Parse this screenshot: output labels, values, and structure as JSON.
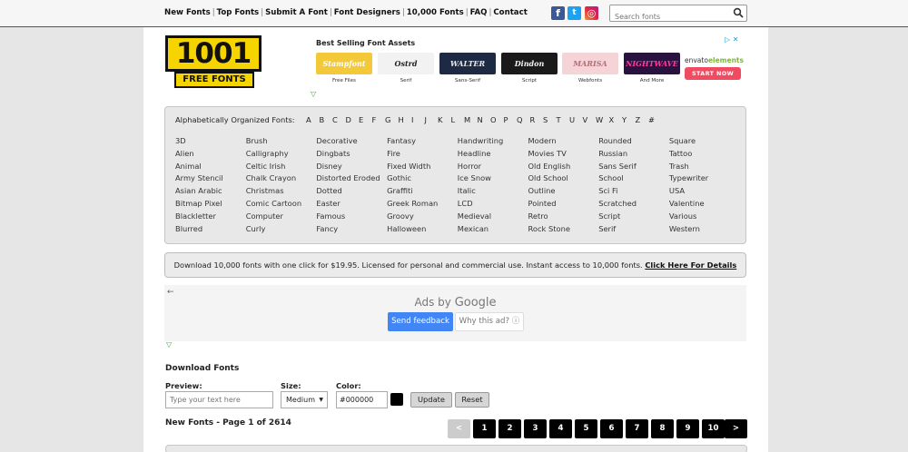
{
  "nav": {
    "items": [
      "New Fonts",
      "Top Fonts",
      "Submit A Font",
      "Font Designers",
      "10,000 Fonts",
      "FAQ",
      "Contact"
    ],
    "separator": "|"
  },
  "social": {
    "facebook": "f",
    "twitter": "t",
    "instagram": "◎"
  },
  "search": {
    "placeholder": "Search fonts"
  },
  "logo": {
    "number": "1001",
    "text": "FREE FONTS"
  },
  "ad": {
    "title": "Best Selling Font Assets",
    "cards": [
      {
        "thumb": "Stampfont",
        "caption": "Free Files",
        "bg": "#f3c93a",
        "fg": "#fff"
      },
      {
        "thumb": "Ostrd",
        "caption": "Serif",
        "bg": "#f2f2f2",
        "fg": "#222"
      },
      {
        "thumb": "WALTER",
        "caption": "Sans-Serif",
        "bg": "#1e2a44",
        "fg": "#e8e8e8"
      },
      {
        "thumb": "Dindon",
        "caption": "Script",
        "bg": "#1a1a1a",
        "fg": "#f5f5f5"
      },
      {
        "thumb": "MARISA",
        "caption": "Webfonts",
        "bg": "#f5d3d6",
        "fg": "#b07078"
      },
      {
        "thumb": "NIGHTWAVE",
        "caption": "And More",
        "bg": "#2a1240",
        "fg": "#ff3d9a"
      }
    ],
    "envato_brand_a": "envato",
    "envato_brand_b": "elements",
    "envato_cta": "START NOW",
    "close_marks": "▷ ✕"
  },
  "alphabet": {
    "label": "Alphabetically Organized Fonts:",
    "letters": [
      "A",
      "B",
      "C",
      "D",
      "E",
      "F",
      "G",
      "H",
      "I",
      "J",
      "K",
      "L",
      "M",
      "N",
      "O",
      "P",
      "Q",
      "R",
      "S",
      "T",
      "U",
      "V",
      "W",
      "X",
      "Y",
      "Z",
      "#"
    ]
  },
  "categories": [
    [
      "3D",
      "Alien",
      "Animal",
      "Army Stencil",
      "Asian Arabic",
      "Bitmap Pixel",
      "Blackletter",
      "Blurred"
    ],
    [
      "Brush",
      "Calligraphy",
      "Celtic Irish",
      "Chalk Crayon",
      "Christmas",
      "Comic Cartoon",
      "Computer",
      "Curly"
    ],
    [
      "Decorative",
      "Dingbats",
      "Disney",
      "Distorted Eroded",
      "Dotted",
      "Easter",
      "Famous",
      "Fancy"
    ],
    [
      "Fantasy",
      "Fire",
      "Fixed Width",
      "Gothic",
      "Graffiti",
      "Greek Roman",
      "Groovy",
      "Halloween"
    ],
    [
      "Handwriting",
      "Headline",
      "Horror",
      "Ice Snow",
      "Italic",
      "LCD",
      "Medieval",
      "Mexican"
    ],
    [
      "Modern",
      "Movies TV",
      "Old English",
      "Old School",
      "Outline",
      "Pointed",
      "Retro",
      "Rock Stone"
    ],
    [
      "Rounded",
      "Russian",
      "Sans Serif",
      "School",
      "Sci Fi",
      "Scratched",
      "Script",
      "Serif"
    ],
    [
      "Square",
      "Tattoo",
      "Trash",
      "Typewriter",
      "USA",
      "Valentine",
      "Various",
      "Western"
    ]
  ],
  "promo": {
    "text": "Download 10,000 fonts with one click for $19.95. Licensed for personal and commercial use. Instant access to 10,000 fonts. ",
    "link": "Click Here For Details"
  },
  "google_ad": {
    "back": "←",
    "ads_by": "Ads by",
    "google": "Google",
    "send_feedback": "Send feedback",
    "why": "Why this ad? ⓘ"
  },
  "download": {
    "title": "Download Fonts",
    "preview_label": "Preview:",
    "preview_placeholder": "Type your text here",
    "size_label": "Size:",
    "size_value": "Medium",
    "color_label": "Color:",
    "color_value": "#000000",
    "swatch_color": "#000000",
    "update": "Update",
    "reset": "Reset"
  },
  "pagination": {
    "heading": "New Fonts - Page 1 of 2614",
    "prev": "<",
    "pages": [
      "1",
      "2",
      "3",
      "4",
      "5",
      "6",
      "7",
      "8",
      "9",
      "10"
    ],
    "next": ">"
  }
}
